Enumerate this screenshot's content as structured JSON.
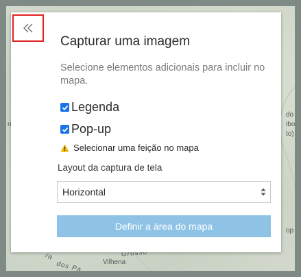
{
  "map": {
    "labels": {
      "left_fragment": "no",
      "right_fragment_1": "do",
      "right_fragment_2": "ibo",
      "right_fragment_3": "to)",
      "right_fragment_4": "op",
      "mato_grosso": "Grosso",
      "vilhena": "Vilhena",
      "serra_1": "Se",
      "serra_2": "ra",
      "dos_parecis": "dos Pa"
    }
  },
  "panel": {
    "title": "Capturar uma imagem",
    "subtitle": "Selecione elementos adicionais para incluir no mapa.",
    "options": [
      {
        "label": "Legenda",
        "checked": true
      },
      {
        "label": "Pop-up",
        "checked": true
      }
    ],
    "warning": "Selecionar uma feição no mapa",
    "layout_label": "Layout da captura de tela",
    "layout_select": {
      "value": "Horizontal"
    },
    "define_button": "Definir a área do mapa"
  },
  "colors": {
    "accent": "#1a73e8",
    "button_disabled": "#8ec3e6",
    "highlight_border": "#e02020",
    "warning": "#f2b300"
  },
  "icons": {
    "collapse": "double-chevron-left-icon",
    "warning": "warning-triangle-icon",
    "select": "up-down-arrows-icon"
  }
}
